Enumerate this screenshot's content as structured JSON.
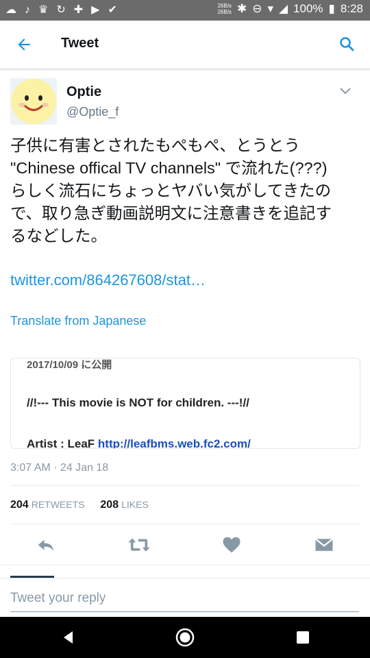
{
  "status_bar": {
    "net_up": "26B/s",
    "net_down": "26B/s",
    "battery": "100%",
    "time": "8:28"
  },
  "app_bar": {
    "title": "Tweet"
  },
  "tweet": {
    "author_name": "Optie",
    "author_handle": "@Optie_f",
    "text": "子供に有害とされたもぺもぺ、とうとう\n\"Chinese offical TV channels\" で流れた(???)\nらしく流石にちょっとヤバい気がしてきたの\nで、取り急ぎ動画説明文に注意書きを追記す\nるなどした。",
    "link": "twitter.com/864267608/stat…",
    "translate": "Translate from Japanese",
    "timestamp": "3:07 AM · 24 Jan 18",
    "retweets_count": "204",
    "retweets_label": "RETWEETS",
    "likes_count": "208",
    "likes_label": "LIKES"
  },
  "card": {
    "date_line": "2017/10/09 に公開",
    "warning": "//!--- This movie is NOT for children. ---!//",
    "artist_prefix": "Artist : LeaF ",
    "artist_url": "http://leafbms.web.fc2.com/"
  },
  "reply": {
    "placeholder": "Tweet your reply"
  },
  "icons": {
    "back": "arrow-left-icon",
    "search": "search-icon",
    "more": "chevron-down-icon",
    "reply": "reply-icon",
    "retweet": "retweet-icon",
    "like": "heart-icon",
    "dm": "envelope-icon"
  },
  "colors": {
    "accent": "#1b95e0",
    "status_bar": "#6b6b6b",
    "nav_bar": "#000000",
    "secondary_text": "#657786"
  }
}
